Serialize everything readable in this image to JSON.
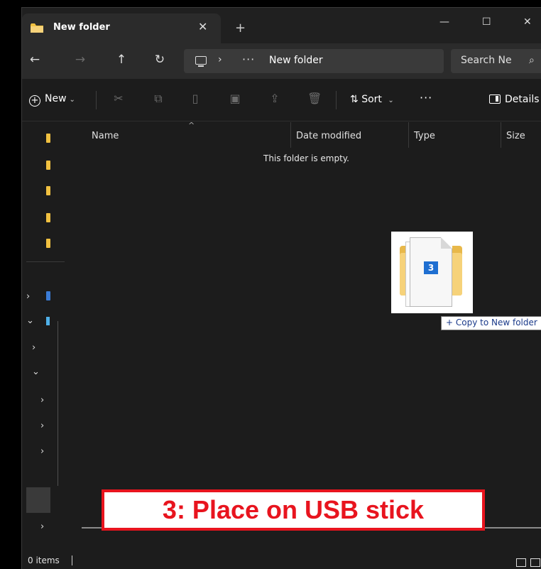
{
  "window": {
    "tab_title": "New folder",
    "tab_close": "✕",
    "new_tab": "+",
    "minimize": "—",
    "maximize": "☐",
    "close": "✕"
  },
  "nav": {
    "back": "←",
    "forward": "→",
    "up": "↑",
    "refresh": "↻",
    "breadcrumb_sep": "›",
    "breadcrumb_more": "···",
    "breadcrumb_current": "New folder",
    "search_placeholder": "Search New folder",
    "search_visible": "Search Ne"
  },
  "toolbar": {
    "new_label": "New",
    "sort_label": "Sort",
    "more_label": "···",
    "details_label": "Details",
    "icons": [
      "cut-icon",
      "copy-icon",
      "paste-icon",
      "rename-icon",
      "share-icon",
      "delete-icon"
    ]
  },
  "columns": {
    "name": "Name",
    "date_modified": "Date modified",
    "type": "Type",
    "size": "Size"
  },
  "content": {
    "empty_message": "This folder is empty."
  },
  "drag": {
    "badge_count": "3",
    "tooltip": "+ Copy to New folder"
  },
  "status": {
    "items": "0 items"
  },
  "overlay": {
    "caption": "3: Place on USB stick"
  },
  "colors": {
    "accent_red": "#e8141e",
    "folder_yellow": "#f0c040",
    "badge_blue": "#1f6fd1"
  }
}
